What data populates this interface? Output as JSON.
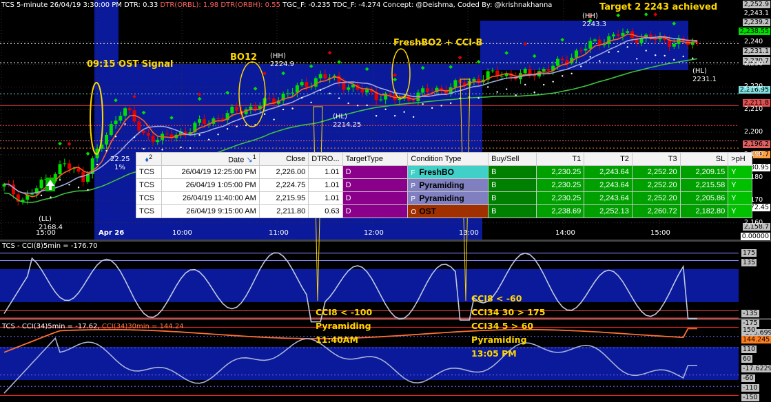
{
  "header": {
    "title": "TCS 5-minute 26/04/19 3:30:00 PM DTR: 0.33 ",
    "dtr_orbl": "DTR(ORBL): 1.98 ",
    "dtr_orbh": "DTR(ORBH): 0.55 ",
    "rest": "TGC_F: -0.235 TDC_F: -4.274 Concept: @Deishma, Coded By: @krishnakhanna"
  },
  "annotations": {
    "ost_signal": "09:15 OST Signal",
    "bo12": "BO12",
    "freshbo2": "FreshBO2 + CCI-B",
    "target2": "Target 2 2243 achieved",
    "cci8_left_1": "CCI8 < -100",
    "cci8_left_2": "Pyramiding",
    "cci8_left_3": "11:40AM",
    "cci8_right_1": "CCI8 < -60",
    "cci8_right_2": "CCI34 30 > 175",
    "cci8_right_3": "CCI34 5 > 60",
    "cci8_right_4": "Pyramiding",
    "cci8_right_5": "13:05 PM"
  },
  "pivots": {
    "hh1_tag": "(HH)",
    "hh1_val": "2224.9",
    "hh2_tag": "(HH)",
    "hh2_val": "2243.3",
    "hl1_tag": "(HL)",
    "hl1_val": "2214.25",
    "hl2_tag": "(HL)",
    "hl2_val": "2231.1",
    "ll_tag": "(LL)",
    "ll_val": "2168.4",
    "mid_val": "22.25",
    "mid_pct": "1%"
  },
  "scan_table": {
    "headers": [
      "Date",
      "Close",
      "DTRO...",
      "TargetType",
      "Condition Type",
      "Buy/Sell",
      "T1",
      "T2",
      "T3",
      "SL",
      ">pH"
    ],
    "header_sort_markers": [
      "2",
      "1"
    ],
    "rows": [
      {
        "sym": "TCS",
        "date": "26/04/19 12:25:00 PM",
        "close": "2,226.00",
        "dtro": "1.01",
        "target": "D",
        "cond_code": "F",
        "cond": "FreshBO",
        "bs": "B",
        "t1": "2,230.25",
        "t2": "2,243.64",
        "t3": "2,252.20",
        "sl": "2,209.15",
        "ph": "Y"
      },
      {
        "sym": "TCS",
        "date": "26/04/19 1:05:00 PM",
        "close": "2,224.75",
        "dtro": "1.01",
        "target": "D",
        "cond_code": "P",
        "cond": "Pyramiding",
        "bs": "B",
        "t1": "2,230.25",
        "t2": "2,243.64",
        "t3": "2,252.20",
        "sl": "2,215.58",
        "ph": "Y"
      },
      {
        "sym": "TCS",
        "date": "26/04/19 11:40:00 AM",
        "close": "2,215.95",
        "dtro": "1.01",
        "target": "D",
        "cond_code": "P",
        "cond": "Pyramiding",
        "bs": "B",
        "t1": "2,230.25",
        "t2": "2,243.64",
        "t3": "2,252.20",
        "sl": "2,205.86",
        "ph": "Y"
      },
      {
        "sym": "TCS",
        "date": "26/04/19 9:15:00 AM",
        "close": "2,211.80",
        "dtro": "0.63",
        "target": "D",
        "cond_code": "O",
        "cond": "OST",
        "bs": "B",
        "t1": "2,238.69",
        "t2": "2,252.13",
        "t3": "2,260.72",
        "sl": "2,182.80",
        "ph": "Y"
      }
    ],
    "cond_colors": [
      "#40d0c8",
      "#8080c0",
      "#8080c0",
      "#a03000"
    ]
  },
  "price_axis": {
    "ticks": [
      "2,240",
      "2,230",
      "2,220",
      "2,210",
      "2,200",
      "2,190",
      "2,180",
      "2,170",
      "2,160"
    ],
    "labels": [
      {
        "text": "2,252.9",
        "bg": "#c0c0c0"
      },
      {
        "text": "2,243.1",
        "bg": "#000000",
        "fg": "#ffffff"
      },
      {
        "text": "2,239.2",
        "bg": "#c0c0c0"
      },
      {
        "text": "2,238.55",
        "bg": "#00e000"
      },
      {
        "text": "2,231.1",
        "bg": "#c0c0c0"
      },
      {
        "text": "2,230.7",
        "bg": "#c0c0c0"
      },
      {
        "text": "2,216.95",
        "bg": "#80e0e0"
      },
      {
        "text": "2,211.8",
        "bg": "#e05050"
      },
      {
        "text": "2,196.2",
        "bg": "#e06060"
      },
      {
        "text": "94.7",
        "bg": "#ffa040"
      },
      {
        "text": "80.95",
        "bg": "#ffffff"
      },
      {
        "text": "72.45",
        "bg": "#ffffff"
      },
      {
        "text": "2,158.7",
        "bg": "#c0c0c0"
      },
      {
        "text": "0.00000",
        "bg": "#ffffff"
      }
    ]
  },
  "time_axis": [
    "15:00",
    "Apr 26",
    "10:00",
    "11:00",
    "12:00",
    "13:00",
    "14:00",
    "15:00"
  ],
  "cci8_panel": {
    "title": "TCS - CCI(8)5min = -176.70",
    "levels": [
      "175",
      "135",
      "-135",
      "-175",
      "-176.699"
    ]
  },
  "cci34_panel": {
    "title_a": "TCS - CCI(34)5min = -17.62, ",
    "title_b": "CCI(34)30min = 144.24",
    "levels": [
      "150",
      "144.245",
      "110",
      "60",
      "-17.6229",
      "-60",
      "-110",
      "-150"
    ]
  },
  "chart_data": [
    {
      "type": "candlestick",
      "title": "TCS 5-minute 26/04/19 3:30:00 PM",
      "ylim": [
        2155,
        2256
      ],
      "x_labels": [
        "15:00",
        "Apr 26",
        "10:00",
        "11:00",
        "12:00",
        "13:00",
        "14:00",
        "15:00"
      ],
      "close_path": [
        2176,
        2170,
        2178,
        2186,
        2180,
        2196,
        2211.8,
        2199,
        2197,
        2200,
        2204,
        2207,
        2210,
        2212,
        2216,
        2220,
        2224.9,
        2222,
        2218,
        2216.2,
        2214.25,
        2217,
        2219,
        2221,
        2224,
        2226,
        2224.75,
        2227,
        2230,
        2236,
        2240,
        2243.3,
        2242,
        2241,
        2240,
        2238.55
      ],
      "series": [
        {
          "name": "TCS",
          "color": "#00e000"
        }
      ]
    },
    {
      "type": "line",
      "title": "TCS - CCI(8)5min = -176.70",
      "ylim": [
        -200,
        200
      ],
      "levels": [
        175,
        135,
        -135,
        -175
      ],
      "series": [
        {
          "name": "CCI(8)5min",
          "last": -176.7
        }
      ]
    },
    {
      "type": "line",
      "title": "TCS - CCI(34)5min = -17.62, CCI(34)30min = 144.24",
      "ylim": [
        -160,
        160
      ],
      "series": [
        {
          "name": "CCI(34)5min",
          "last": -17.62
        },
        {
          "name": "CCI(34)30min",
          "last": 144.24
        }
      ]
    }
  ]
}
